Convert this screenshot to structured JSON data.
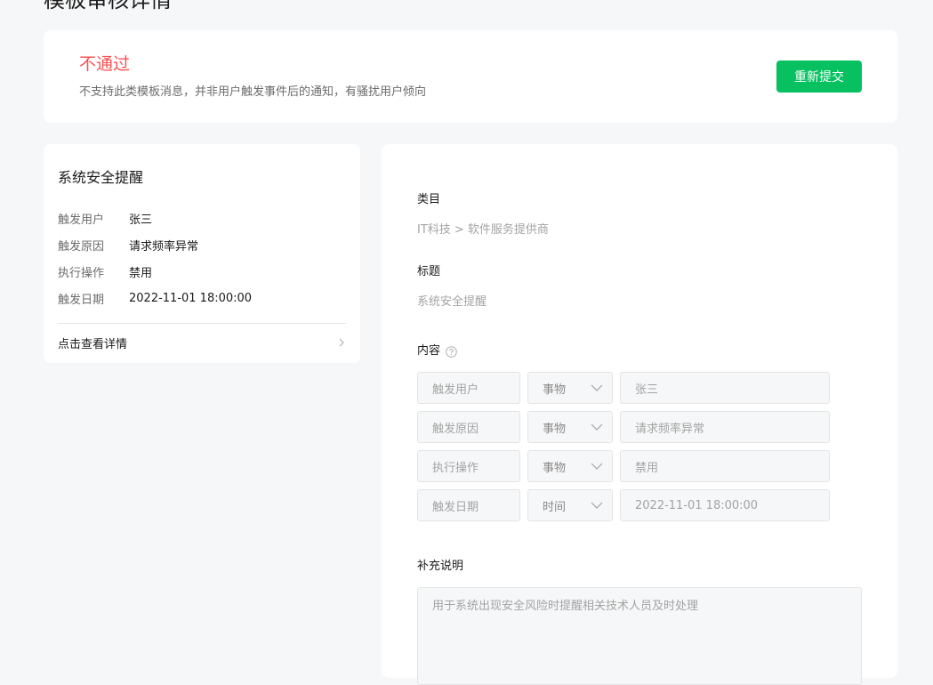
{
  "page": {
    "title": "模板审核详情"
  },
  "status": {
    "title": "不通过",
    "reason": "不支持此类模板消息，并非用户触发事件后的通知，有骚扰用户倾向",
    "resubmit_label": "重新提交"
  },
  "preview": {
    "title": "系统安全提醒",
    "rows": [
      {
        "key": "触发用户",
        "value": "张三"
      },
      {
        "key": "触发原因",
        "value": "请求频率异常"
      },
      {
        "key": "执行操作",
        "value": "禁用"
      },
      {
        "key": "触发日期",
        "value": "2022-11-01 18:00:00"
      }
    ],
    "link_label": "点击查看详情"
  },
  "detail": {
    "category_label": "类目",
    "category_value": "IT科技 > 软件服务提供商",
    "title_label": "标题",
    "title_value": "系统安全提醒",
    "content_label": "内容",
    "content_rows": [
      {
        "key": "触发用户",
        "type": "事物",
        "value": "张三"
      },
      {
        "key": "触发原因",
        "type": "事物",
        "value": "请求频率异常"
      },
      {
        "key": "执行操作",
        "type": "事物",
        "value": "禁用"
      },
      {
        "key": "触发日期",
        "type": "时间",
        "value": "2022-11-01 18:00:00"
      }
    ],
    "note_label": "补充说明",
    "note_value": "用于系统出现安全风险时提醒相关技术人员及时处理"
  },
  "colors": {
    "accent": "#07c160",
    "fail": "#fa5151",
    "background": "#f6f7f8"
  },
  "icons": [
    "chevron-right-icon",
    "help-icon",
    "chevron-down-icon"
  ]
}
